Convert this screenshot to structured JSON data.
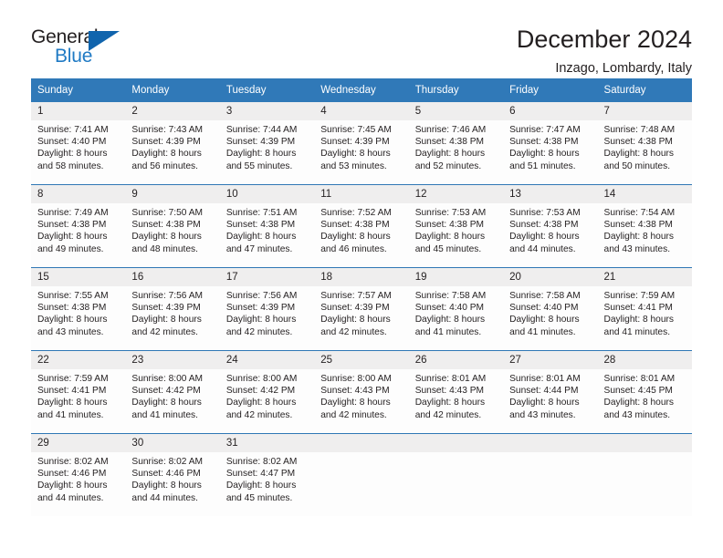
{
  "brand": {
    "name_top": "General",
    "name_bottom": "Blue",
    "triangle_icon": "triangle-icon",
    "color_black": "#231f20",
    "color_blue": "#1f7ac4",
    "triangle_color": "#1064ad"
  },
  "header": {
    "title": "December 2024",
    "subtitle": "Inzago, Lombardy, Italy"
  },
  "theme": {
    "header_bg": "#3079b8",
    "row_border": "#2f77b5",
    "daynum_band": "#efeeee",
    "text": "#231f20"
  },
  "weekdays": [
    {
      "label": "Sunday"
    },
    {
      "label": "Monday"
    },
    {
      "label": "Tuesday"
    },
    {
      "label": "Wednesday"
    },
    {
      "label": "Thursday"
    },
    {
      "label": "Friday"
    },
    {
      "label": "Saturday"
    }
  ],
  "weeks": [
    [
      {
        "day": "1",
        "sunrise": "Sunrise: 7:41 AM",
        "sunset": "Sunset: 4:40 PM",
        "daylight_1": "Daylight: 8 hours",
        "daylight_2": "and 58 minutes."
      },
      {
        "day": "2",
        "sunrise": "Sunrise: 7:43 AM",
        "sunset": "Sunset: 4:39 PM",
        "daylight_1": "Daylight: 8 hours",
        "daylight_2": "and 56 minutes."
      },
      {
        "day": "3",
        "sunrise": "Sunrise: 7:44 AM",
        "sunset": "Sunset: 4:39 PM",
        "daylight_1": "Daylight: 8 hours",
        "daylight_2": "and 55 minutes."
      },
      {
        "day": "4",
        "sunrise": "Sunrise: 7:45 AM",
        "sunset": "Sunset: 4:39 PM",
        "daylight_1": "Daylight: 8 hours",
        "daylight_2": "and 53 minutes."
      },
      {
        "day": "5",
        "sunrise": "Sunrise: 7:46 AM",
        "sunset": "Sunset: 4:38 PM",
        "daylight_1": "Daylight: 8 hours",
        "daylight_2": "and 52 minutes."
      },
      {
        "day": "6",
        "sunrise": "Sunrise: 7:47 AM",
        "sunset": "Sunset: 4:38 PM",
        "daylight_1": "Daylight: 8 hours",
        "daylight_2": "and 51 minutes."
      },
      {
        "day": "7",
        "sunrise": "Sunrise: 7:48 AM",
        "sunset": "Sunset: 4:38 PM",
        "daylight_1": "Daylight: 8 hours",
        "daylight_2": "and 50 minutes."
      }
    ],
    [
      {
        "day": "8",
        "sunrise": "Sunrise: 7:49 AM",
        "sunset": "Sunset: 4:38 PM",
        "daylight_1": "Daylight: 8 hours",
        "daylight_2": "and 49 minutes."
      },
      {
        "day": "9",
        "sunrise": "Sunrise: 7:50 AM",
        "sunset": "Sunset: 4:38 PM",
        "daylight_1": "Daylight: 8 hours",
        "daylight_2": "and 48 minutes."
      },
      {
        "day": "10",
        "sunrise": "Sunrise: 7:51 AM",
        "sunset": "Sunset: 4:38 PM",
        "daylight_1": "Daylight: 8 hours",
        "daylight_2": "and 47 minutes."
      },
      {
        "day": "11",
        "sunrise": "Sunrise: 7:52 AM",
        "sunset": "Sunset: 4:38 PM",
        "daylight_1": "Daylight: 8 hours",
        "daylight_2": "and 46 minutes."
      },
      {
        "day": "12",
        "sunrise": "Sunrise: 7:53 AM",
        "sunset": "Sunset: 4:38 PM",
        "daylight_1": "Daylight: 8 hours",
        "daylight_2": "and 45 minutes."
      },
      {
        "day": "13",
        "sunrise": "Sunrise: 7:53 AM",
        "sunset": "Sunset: 4:38 PM",
        "daylight_1": "Daylight: 8 hours",
        "daylight_2": "and 44 minutes."
      },
      {
        "day": "14",
        "sunrise": "Sunrise: 7:54 AM",
        "sunset": "Sunset: 4:38 PM",
        "daylight_1": "Daylight: 8 hours",
        "daylight_2": "and 43 minutes."
      }
    ],
    [
      {
        "day": "15",
        "sunrise": "Sunrise: 7:55 AM",
        "sunset": "Sunset: 4:38 PM",
        "daylight_1": "Daylight: 8 hours",
        "daylight_2": "and 43 minutes."
      },
      {
        "day": "16",
        "sunrise": "Sunrise: 7:56 AM",
        "sunset": "Sunset: 4:39 PM",
        "daylight_1": "Daylight: 8 hours",
        "daylight_2": "and 42 minutes."
      },
      {
        "day": "17",
        "sunrise": "Sunrise: 7:56 AM",
        "sunset": "Sunset: 4:39 PM",
        "daylight_1": "Daylight: 8 hours",
        "daylight_2": "and 42 minutes."
      },
      {
        "day": "18",
        "sunrise": "Sunrise: 7:57 AM",
        "sunset": "Sunset: 4:39 PM",
        "daylight_1": "Daylight: 8 hours",
        "daylight_2": "and 42 minutes."
      },
      {
        "day": "19",
        "sunrise": "Sunrise: 7:58 AM",
        "sunset": "Sunset: 4:40 PM",
        "daylight_1": "Daylight: 8 hours",
        "daylight_2": "and 41 minutes."
      },
      {
        "day": "20",
        "sunrise": "Sunrise: 7:58 AM",
        "sunset": "Sunset: 4:40 PM",
        "daylight_1": "Daylight: 8 hours",
        "daylight_2": "and 41 minutes."
      },
      {
        "day": "21",
        "sunrise": "Sunrise: 7:59 AM",
        "sunset": "Sunset: 4:41 PM",
        "daylight_1": "Daylight: 8 hours",
        "daylight_2": "and 41 minutes."
      }
    ],
    [
      {
        "day": "22",
        "sunrise": "Sunrise: 7:59 AM",
        "sunset": "Sunset: 4:41 PM",
        "daylight_1": "Daylight: 8 hours",
        "daylight_2": "and 41 minutes."
      },
      {
        "day": "23",
        "sunrise": "Sunrise: 8:00 AM",
        "sunset": "Sunset: 4:42 PM",
        "daylight_1": "Daylight: 8 hours",
        "daylight_2": "and 41 minutes."
      },
      {
        "day": "24",
        "sunrise": "Sunrise: 8:00 AM",
        "sunset": "Sunset: 4:42 PM",
        "daylight_1": "Daylight: 8 hours",
        "daylight_2": "and 42 minutes."
      },
      {
        "day": "25",
        "sunrise": "Sunrise: 8:00 AM",
        "sunset": "Sunset: 4:43 PM",
        "daylight_1": "Daylight: 8 hours",
        "daylight_2": "and 42 minutes."
      },
      {
        "day": "26",
        "sunrise": "Sunrise: 8:01 AM",
        "sunset": "Sunset: 4:43 PM",
        "daylight_1": "Daylight: 8 hours",
        "daylight_2": "and 42 minutes."
      },
      {
        "day": "27",
        "sunrise": "Sunrise: 8:01 AM",
        "sunset": "Sunset: 4:44 PM",
        "daylight_1": "Daylight: 8 hours",
        "daylight_2": "and 43 minutes."
      },
      {
        "day": "28",
        "sunrise": "Sunrise: 8:01 AM",
        "sunset": "Sunset: 4:45 PM",
        "daylight_1": "Daylight: 8 hours",
        "daylight_2": "and 43 minutes."
      }
    ],
    [
      {
        "day": "29",
        "sunrise": "Sunrise: 8:02 AM",
        "sunset": "Sunset: 4:46 PM",
        "daylight_1": "Daylight: 8 hours",
        "daylight_2": "and 44 minutes."
      },
      {
        "day": "30",
        "sunrise": "Sunrise: 8:02 AM",
        "sunset": "Sunset: 4:46 PM",
        "daylight_1": "Daylight: 8 hours",
        "daylight_2": "and 44 minutes."
      },
      {
        "day": "31",
        "sunrise": "Sunrise: 8:02 AM",
        "sunset": "Sunset: 4:47 PM",
        "daylight_1": "Daylight: 8 hours",
        "daylight_2": "and 45 minutes."
      },
      {
        "day": "",
        "sunrise": "",
        "sunset": "",
        "daylight_1": "",
        "daylight_2": ""
      },
      {
        "day": "",
        "sunrise": "",
        "sunset": "",
        "daylight_1": "",
        "daylight_2": ""
      },
      {
        "day": "",
        "sunrise": "",
        "sunset": "",
        "daylight_1": "",
        "daylight_2": ""
      },
      {
        "day": "",
        "sunrise": "",
        "sunset": "",
        "daylight_1": "",
        "daylight_2": ""
      }
    ]
  ]
}
